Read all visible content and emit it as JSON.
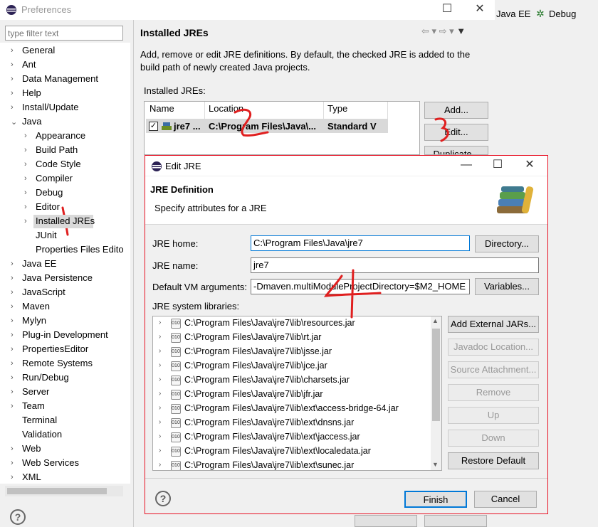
{
  "preferences": {
    "window_title": "Preferences",
    "filter_placeholder": "type filter text",
    "tree": [
      {
        "label": "General",
        "chev": ">"
      },
      {
        "label": "Ant",
        "chev": ">"
      },
      {
        "label": "Data Management",
        "chev": ">"
      },
      {
        "label": "Help",
        "chev": ">"
      },
      {
        "label": "Install/Update",
        "chev": ">"
      },
      {
        "label": "Java",
        "chev": "v"
      },
      {
        "label": "Appearance",
        "chev": ">"
      },
      {
        "label": "Build Path",
        "chev": ">"
      },
      {
        "label": "Code Style",
        "chev": ">"
      },
      {
        "label": "Compiler",
        "chev": ">"
      },
      {
        "label": "Debug",
        "chev": ">"
      },
      {
        "label": "Editor",
        "chev": ">"
      },
      {
        "label": "Installed JREs",
        "chev": ">"
      },
      {
        "label": "JUnit",
        "chev": ""
      },
      {
        "label": "Properties Files Edito",
        "chev": ""
      },
      {
        "label": "Java EE",
        "chev": ">"
      },
      {
        "label": "Java Persistence",
        "chev": ">"
      },
      {
        "label": "JavaScript",
        "chev": ">"
      },
      {
        "label": "Maven",
        "chev": ">"
      },
      {
        "label": "Mylyn",
        "chev": ">"
      },
      {
        "label": "Plug-in Development",
        "chev": ">"
      },
      {
        "label": "PropertiesEditor",
        "chev": ">"
      },
      {
        "label": "Remote Systems",
        "chev": ">"
      },
      {
        "label": "Run/Debug",
        "chev": ">"
      },
      {
        "label": "Server",
        "chev": ">"
      },
      {
        "label": "Team",
        "chev": ">"
      },
      {
        "label": "Terminal",
        "chev": ""
      },
      {
        "label": "Validation",
        "chev": ""
      },
      {
        "label": "Web",
        "chev": ">"
      },
      {
        "label": "Web Services",
        "chev": ">"
      },
      {
        "label": "XML",
        "chev": ">"
      }
    ],
    "page_title": "Installed JREs",
    "description": "Add, remove or edit JRE definitions. By default, the checked JRE is added to the build path of newly created Java projects.",
    "installed_label": "Installed JREs:",
    "columns": [
      "Name",
      "Location",
      "Type"
    ],
    "row": {
      "name": "jre7 ...",
      "location": "C:\\Program Files\\Java\\...",
      "type": "Standard V"
    },
    "buttons": {
      "add": "Add...",
      "edit": "Edit...",
      "duplicate": "Duplicate..."
    }
  },
  "topbar": {
    "javaee": "Java EE",
    "debug": "Debug"
  },
  "edit_jre": {
    "window_title": "Edit JRE",
    "heading": "JRE Definition",
    "subheading": "Specify attributes for a JRE",
    "jre_home_label": "JRE home:",
    "jre_home_value": "C:\\Program Files\\Java\\jre7",
    "directory_button": "Directory...",
    "jre_name_label": "JRE name:",
    "jre_name_value": "jre7",
    "vm_args_label": "Default VM arguments:",
    "vm_args_value": "-Dmaven.multiModuleProjectDirectory=$M2_HOME",
    "variables_button": "Variables...",
    "libraries_label": "JRE system libraries:",
    "libraries": [
      "C:\\Program Files\\Java\\jre7\\lib\\resources.jar",
      "C:\\Program Files\\Java\\jre7\\lib\\rt.jar",
      "C:\\Program Files\\Java\\jre7\\lib\\jsse.jar",
      "C:\\Program Files\\Java\\jre7\\lib\\jce.jar",
      "C:\\Program Files\\Java\\jre7\\lib\\charsets.jar",
      "C:\\Program Files\\Java\\jre7\\lib\\jfr.jar",
      "C:\\Program Files\\Java\\jre7\\lib\\ext\\access-bridge-64.jar",
      "C:\\Program Files\\Java\\jre7\\lib\\ext\\dnsns.jar",
      "C:\\Program Files\\Java\\jre7\\lib\\ext\\jaccess.jar",
      "C:\\Program Files\\Java\\jre7\\lib\\ext\\localedata.jar",
      "C:\\Program Files\\Java\\jre7\\lib\\ext\\sunec.jar"
    ],
    "side_buttons": {
      "add_external": "Add External JARs...",
      "javadoc": "Javadoc Location...",
      "source": "Source Attachment...",
      "remove": "Remove",
      "up": "Up",
      "down": "Down",
      "restore": "Restore Default"
    },
    "finish": "Finish",
    "cancel": "Cancel"
  },
  "annotations": {
    "mark1": "1",
    "mark2": "2",
    "mark3": "3",
    "mark4": "4"
  },
  "colors": {
    "accent_border": "#e81123",
    "annotation": "#e02020",
    "selection": "#d9d9d9"
  }
}
